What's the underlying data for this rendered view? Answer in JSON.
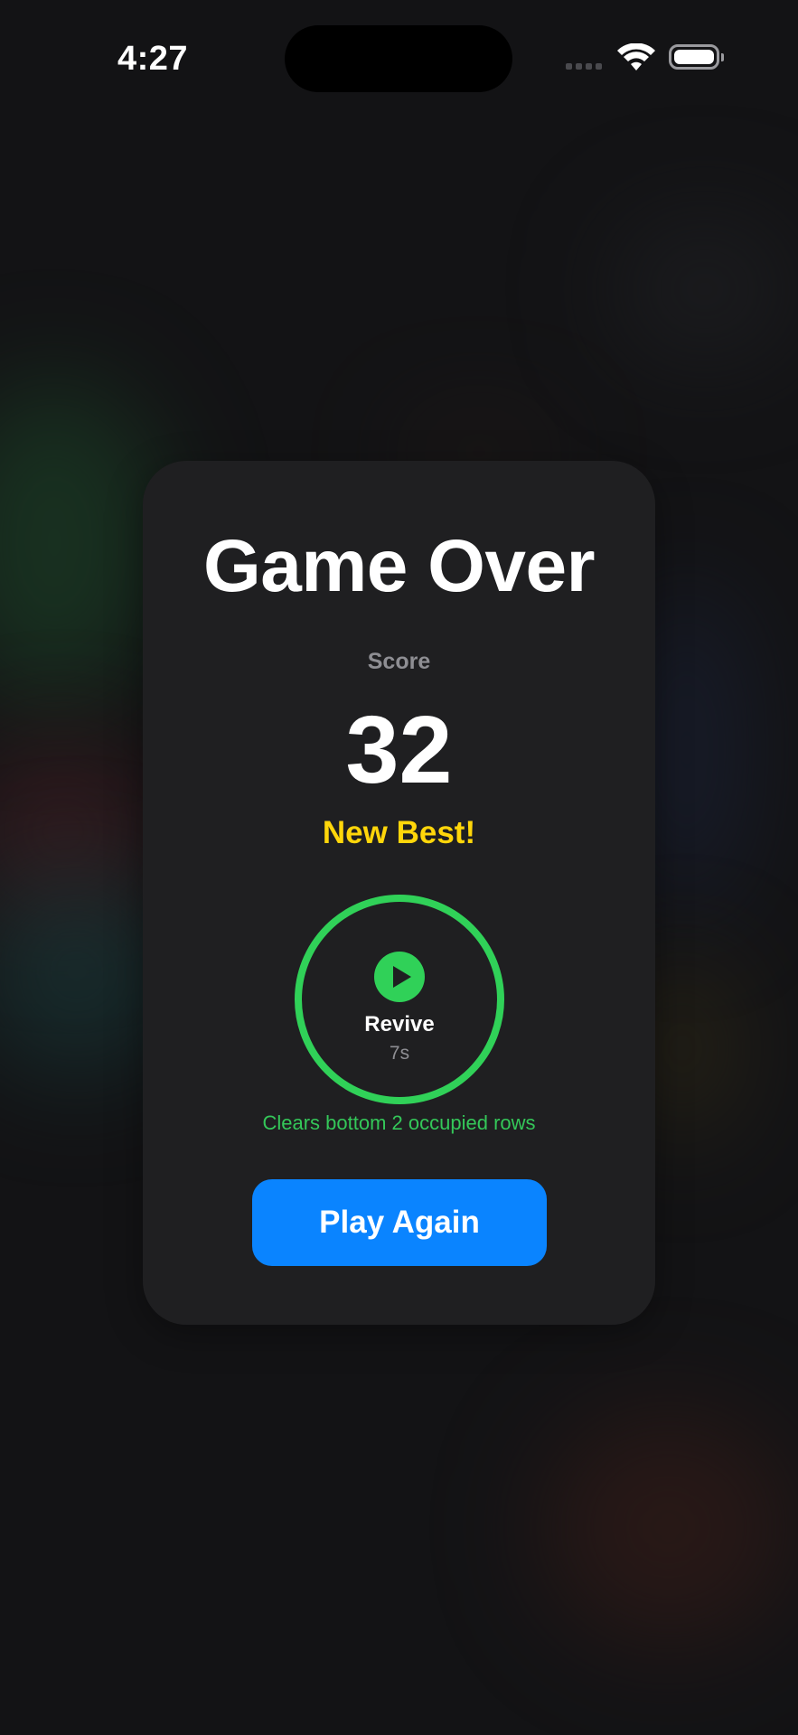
{
  "status_bar": {
    "time": "4:27",
    "icons": [
      "cellular-signal-icon",
      "wifi-icon",
      "battery-icon"
    ]
  },
  "game_over": {
    "title": "Game Over",
    "score_label": "Score",
    "score": "32",
    "new_best": "New Best!",
    "revive": {
      "label": "Revive",
      "timer": "7s",
      "countdown_fraction": 1.0,
      "icon": "play-icon",
      "description": "Clears bottom 2 occupied rows"
    },
    "play_again_label": "Play Again"
  },
  "colors": {
    "background": "#131315",
    "card": "#1f1f21",
    "accent_green": "#30d158",
    "accent_yellow": "#ffd60a",
    "accent_blue": "#0a84ff",
    "secondary_text": "#8e8e93"
  }
}
